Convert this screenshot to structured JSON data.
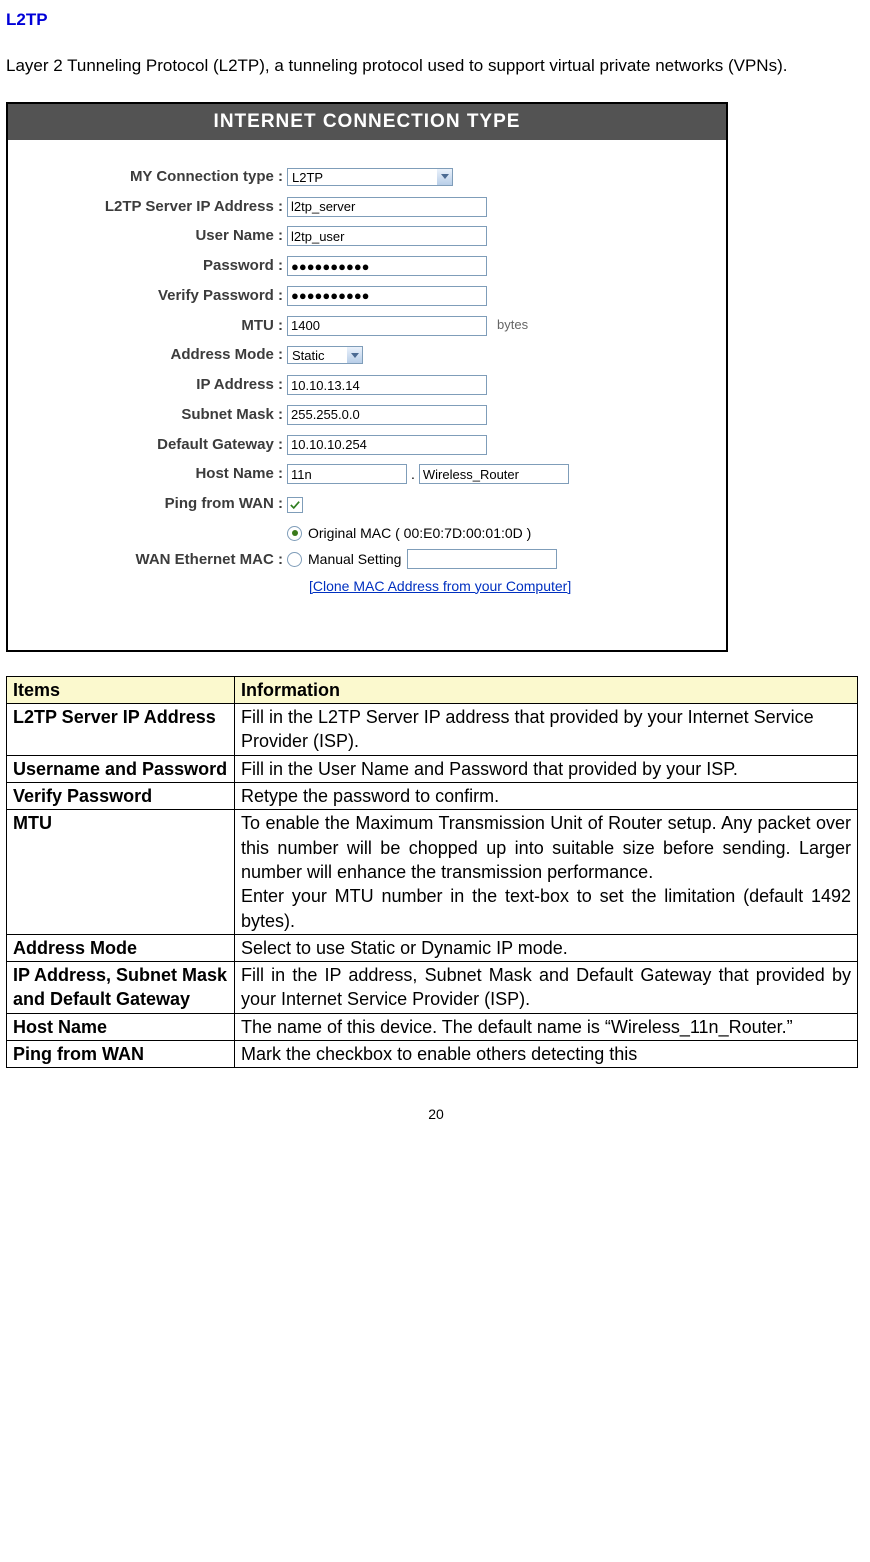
{
  "section_heading": "L2TP",
  "intro": "Layer 2 Tunneling Protocol (L2TP), a tunneling protocol used to support virtual private networks (VPNs).",
  "page_number": "20",
  "panel": {
    "title": "INTERNET CONNECTION TYPE",
    "rows": {
      "conn_type": {
        "label": "MY Connection type :",
        "value": "L2TP"
      },
      "server_ip": {
        "label": "L2TP Server IP Address :",
        "value": "l2tp_server"
      },
      "user": {
        "label": "User Name :",
        "value": "l2tp_user"
      },
      "pass": {
        "label": "Password :",
        "value": "●●●●●●●●●●"
      },
      "vpass": {
        "label": "Verify Password :",
        "value": "●●●●●●●●●●"
      },
      "mtu": {
        "label": "MTU :",
        "value": "1400",
        "unit": "bytes"
      },
      "addr_mode": {
        "label": "Address Mode :",
        "value": "Static"
      },
      "ip": {
        "label": "IP Address :",
        "value": "10.10.13.14"
      },
      "mask": {
        "label": "Subnet Mask :",
        "value": "255.255.0.0"
      },
      "gw": {
        "label": "Default Gateway :",
        "value": "10.10.10.254"
      },
      "host": {
        "label": "Host Name :",
        "v1": "11n",
        "sep": ".",
        "v2": "Wireless_Router"
      },
      "ping": {
        "label": "Ping from WAN :"
      },
      "mac": {
        "label": "WAN Ethernet MAC :",
        "opt1": "Original MAC ( 00:E0:7D:00:01:0D )",
        "opt2": "Manual Setting",
        "clone": "[Clone MAC Address from your Computer]"
      }
    }
  },
  "table": {
    "h1": "Items",
    "h2": "Information",
    "rows": [
      {
        "item": "L2TP Server IP Address",
        "info": "Fill in the L2TP Server IP address that provided by your Internet Service Provider (ISP)."
      },
      {
        "item": "Username and Password",
        "info": "Fill in the User Name and Password that provided by your ISP."
      },
      {
        "item": "Verify Password",
        "info": "Retype the password to confirm."
      },
      {
        "item": "MTU",
        "info": "To enable the Maximum Transmission Unit of Router setup. Any packet over this number will be chopped up into suitable size before sending. Larger number will enhance the transmission performance.\nEnter your MTU number in the text-box to set the limitation (default 1492 bytes)."
      },
      {
        "item": "Address Mode",
        "info": "Select to use Static or Dynamic IP mode."
      },
      {
        "item": "IP Address, Subnet Mask and Default Gateway",
        "info": "Fill in the IP address, Subnet Mask and Default Gateway that provided by your Internet Service Provider (ISP)."
      },
      {
        "item": "Host Name",
        "info": "The name of this device. The default name is “Wireless_11n_Router.”"
      },
      {
        "item": "Ping from WAN",
        "info": "Mark the checkbox to enable others detecting this"
      }
    ]
  }
}
